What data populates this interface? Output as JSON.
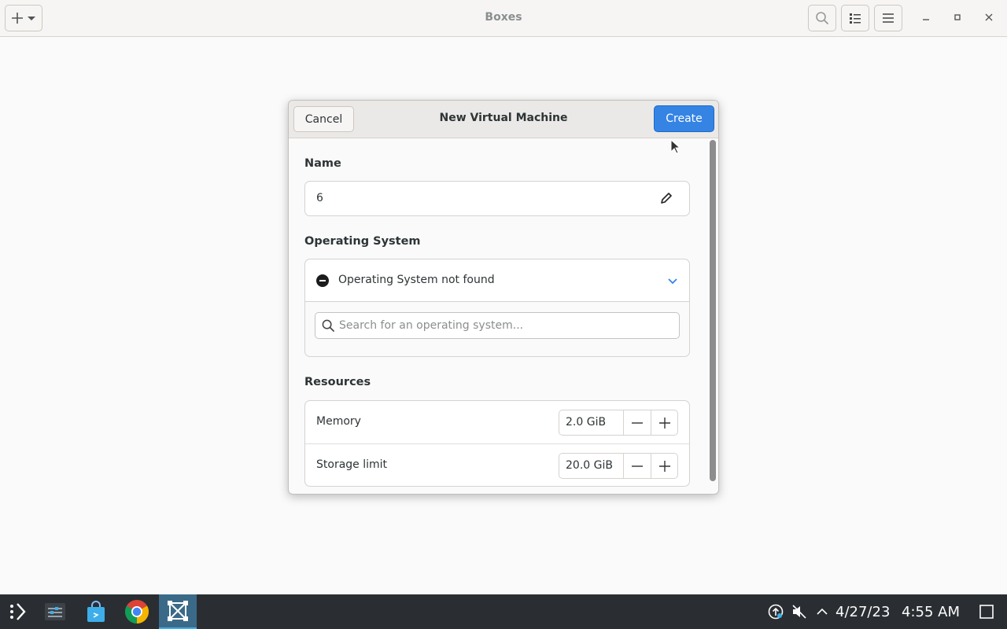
{
  "header": {
    "title": "Boxes",
    "new_button_icon": "plus-icon",
    "search_icon": "search-icon",
    "view_icon": "list-view-icon",
    "menu_icon": "hamburger-menu-icon"
  },
  "dialog": {
    "title": "New Virtual Machine",
    "cancel_label": "Cancel",
    "create_label": "Create",
    "name_section": "Name",
    "name_value": "6",
    "os_section": "Operating System",
    "os_status": "Operating System not found",
    "os_search_placeholder": "Search for an operating system...",
    "resources_section": "Resources",
    "memory_label": "Memory",
    "memory_value": "2.0 GiB",
    "storage_label": "Storage limit",
    "storage_value": "20.0 GiB"
  },
  "taskbar": {
    "date": "4/27/23",
    "time": "4:55 AM"
  },
  "colors": {
    "accent": "#3584e4",
    "taskbar_bg": "#2a2e32",
    "taskbar_active": "#3daee9"
  }
}
